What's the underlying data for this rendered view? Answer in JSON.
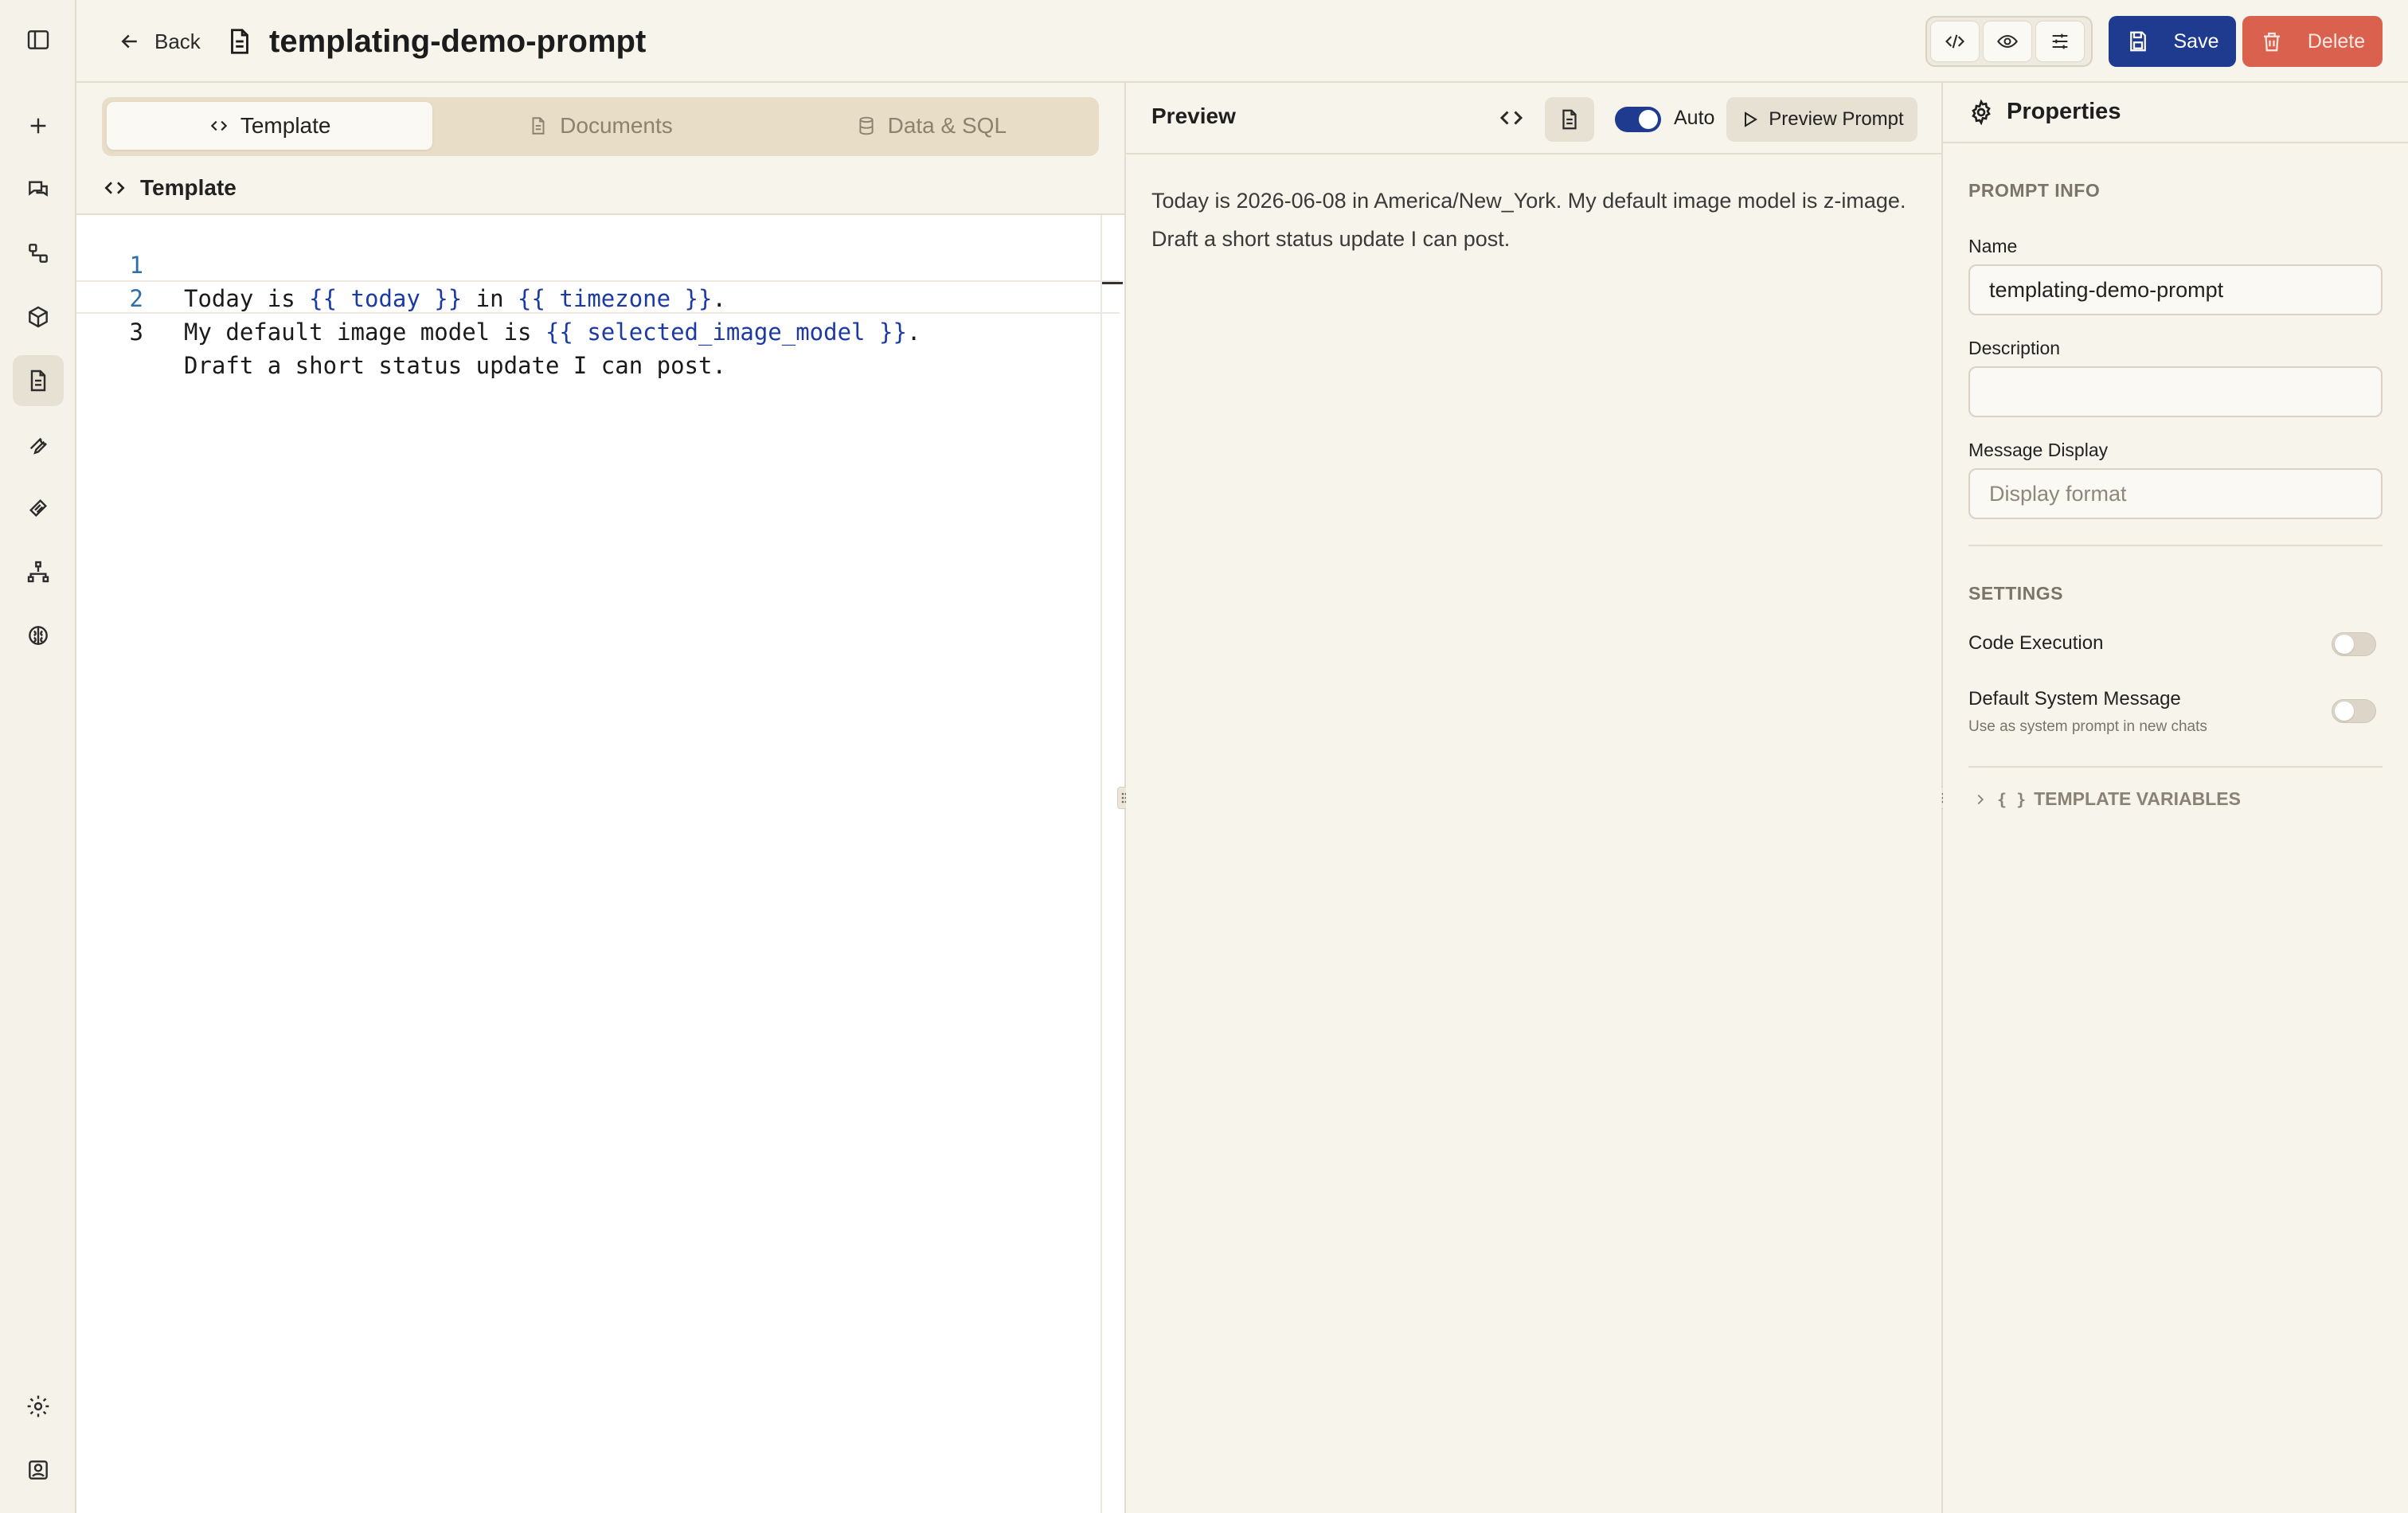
{
  "header": {
    "back_label": "Back",
    "title": "templating-demo-prompt",
    "save_label": "Save",
    "delete_label": "Delete"
  },
  "tabs": [
    {
      "label": "Template",
      "icon": "code-icon",
      "active": true
    },
    {
      "label": "Documents",
      "icon": "file-icon",
      "active": false
    },
    {
      "label": "Data & SQL",
      "icon": "database-icon",
      "active": false
    }
  ],
  "template_section": {
    "label": "Template"
  },
  "editor": {
    "lines": [
      {
        "num": "1",
        "parts": [
          "Today is ",
          "{{ today }}",
          " in ",
          "{{ timezone }}",
          "."
        ]
      },
      {
        "num": "2",
        "parts": [
          "My default image model is ",
          "{{ selected_image_model }}",
          "."
        ]
      },
      {
        "num": "3",
        "parts": [
          "Draft a short status update I can post."
        ]
      }
    ]
  },
  "preview": {
    "title": "Preview",
    "auto_label": "Auto",
    "auto_on": true,
    "preview_button": "Preview Prompt",
    "text": "Today is 2026-06-08 in America/New_York. My default image model is z-image. Draft a short status update I can post."
  },
  "properties": {
    "title": "Properties",
    "prompt_info_label": "PROMPT INFO",
    "name_label": "Name",
    "name_value": "templating-demo-prompt",
    "description_label": "Description",
    "description_value": "",
    "message_display_label": "Message Display",
    "message_display_placeholder": "Display format",
    "settings_label": "SETTINGS",
    "code_execution_label": "Code Execution",
    "code_execution_on": false,
    "default_system_label": "Default System Message",
    "default_system_sub": "Use as system prompt in new chats",
    "default_system_on": false,
    "template_variables_label": "TEMPLATE VARIABLES",
    "template_variables_braces": "{ }"
  },
  "colors": {
    "accent": "#1f3b8f",
    "danger": "#d9614e",
    "background": "#f7f4ec",
    "tab_bar": "#e8ddc7",
    "template_var": "#1b3aa3"
  }
}
